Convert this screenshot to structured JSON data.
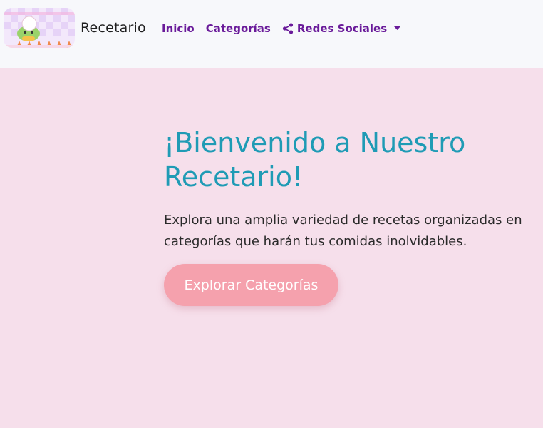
{
  "navbar": {
    "brand_label": "Recetario",
    "logo_icon": "chef-bear-logo-icon",
    "links": [
      {
        "label": "Inicio"
      },
      {
        "label": "Categorías"
      }
    ],
    "dropdown": {
      "label": "Redes Sociales",
      "icon": "share-icon",
      "caret_icon": "chevron-down-icon"
    }
  },
  "hero": {
    "title": "¡Bienvenido a Nuestro Recetario!",
    "lead": "Explora una amplia variedad de recetas organizadas en categorías que harán tus comidas inolvidables.",
    "cta_label": "Explorar Categorías"
  },
  "colors": {
    "page_background": "#f6dfeb",
    "navbar_background": "#f7f8fb",
    "nav_link": "#6a1b9a",
    "hero_title": "#1f9bb5",
    "cta_background": "#f5a1ad"
  }
}
